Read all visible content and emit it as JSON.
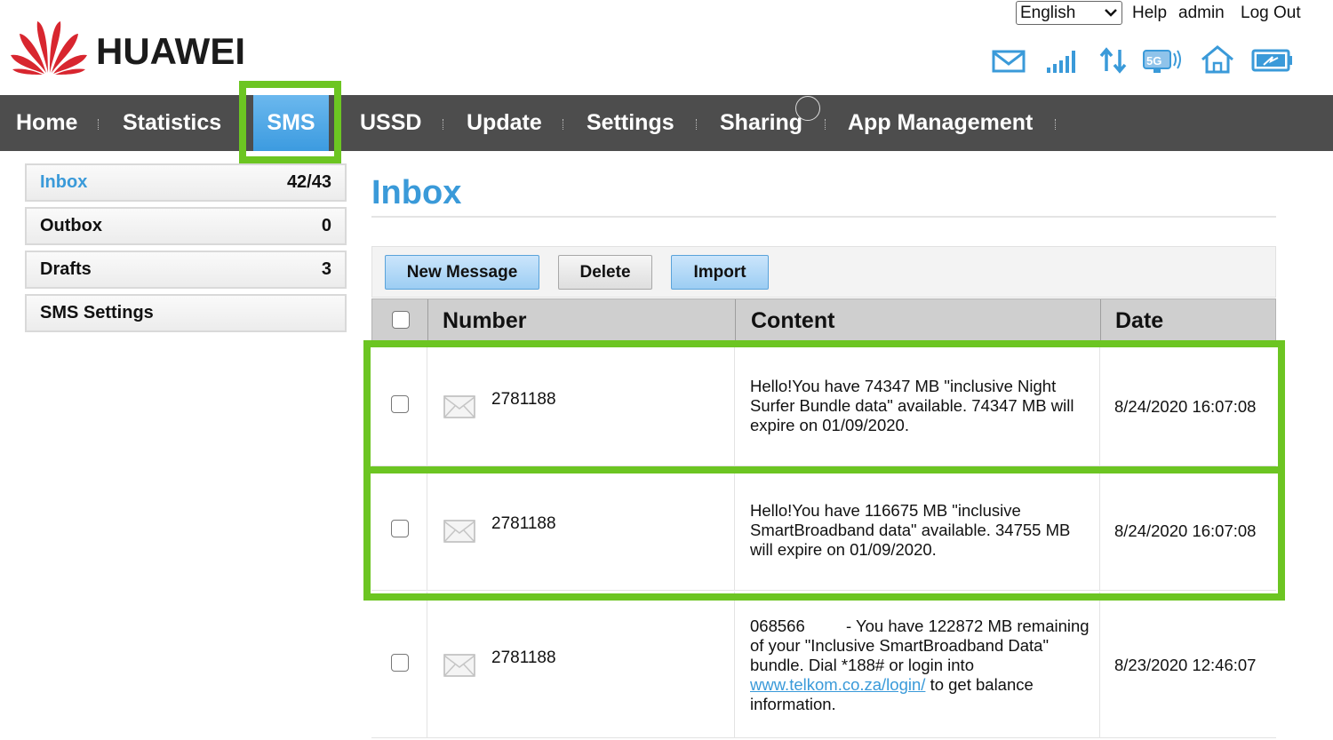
{
  "header": {
    "brand": "HUAWEI",
    "language": "English",
    "links": {
      "help": "Help",
      "user": "admin",
      "logout": "Log Out"
    },
    "status_icons": [
      "mail-icon",
      "signal-icon",
      "data-transfer-icon",
      "5g-icon",
      "home-icon",
      "battery-icon"
    ]
  },
  "nav": {
    "items": [
      {
        "label": "Home"
      },
      {
        "label": "Statistics"
      },
      {
        "label": "SMS",
        "active": true
      },
      {
        "label": "USSD"
      },
      {
        "label": "Update"
      },
      {
        "label": "Settings"
      },
      {
        "label": "Sharing"
      },
      {
        "label": "App Management"
      }
    ]
  },
  "sidebar": {
    "items": [
      {
        "label": "Inbox",
        "count": "42/43",
        "active": true
      },
      {
        "label": "Outbox",
        "count": "0"
      },
      {
        "label": "Drafts",
        "count": "3"
      },
      {
        "label": "SMS Settings",
        "count": ""
      }
    ]
  },
  "main": {
    "title": "Inbox",
    "toolbar": {
      "new_message": "New Message",
      "delete": "Delete",
      "import": "Import"
    },
    "table": {
      "columns": {
        "number": "Number",
        "content": "Content",
        "date": "Date"
      },
      "rows": [
        {
          "number": "2781188",
          "content": "Hello!You have 74347 MB \"inclusive Night Surfer Bundle data\" available. 74347 MB will expire on 01/09/2020.",
          "date": "8/24/2020 16:07:08"
        },
        {
          "number": "2781188",
          "content": "Hello!You have 116675 MB \"inclusive SmartBroadband data\" available. 34755 MB will expire on 01/09/2020.",
          "date": "8/24/2020 16:07:08"
        },
        {
          "number": "2781188",
          "content_before_link": "068566         - You have 122872 MB remaining of your \"Inclusive SmartBroadband Data\" bundle. Dial *188# or login into",
          "link": "www.telkom.co.za/login/",
          "content_after_link": "to get balance information.",
          "date": "8/23/2020 12:46:07"
        }
      ]
    }
  },
  "colors": {
    "accent_blue": "#3a9ad9",
    "nav_bg": "#4d4d4d",
    "highlight_green": "#6cc522",
    "brand_red": "#d8262f"
  }
}
